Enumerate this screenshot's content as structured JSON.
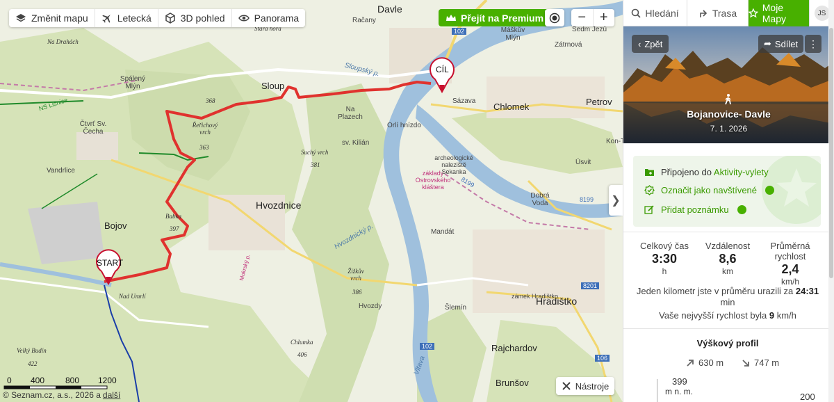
{
  "toolbar": {
    "change_map": "Změnit mapu",
    "aerial": "Letecká",
    "view3d": "3D pohled",
    "panorama": "Panorama"
  },
  "premium_label": "Přejít na Premium",
  "zoom": {
    "minus": "−",
    "plus": "+"
  },
  "map_labels": {
    "davle": "Davle",
    "sloup": "Sloup",
    "hvozdnice": "Hvozdnice",
    "bojov": "Bojov",
    "chlomek": "Chlomek",
    "petrov": "Petrov",
    "hradistko": "Hradištko",
    "rajchardov": "Rajchardov",
    "brunsov": "Brunšov",
    "ctvrt_sv_cecha": "Čtvrť Sv. Čecha",
    "spaleny_mlyn": "Spálený Mlýn",
    "vrchy_na_drahach": "Na Drahách",
    "vandrlice": "Vandrlice",
    "rechovy_vrch": "Řeřichový vrch",
    "babka": "Babka",
    "suchy_vrch": "Suchý vrch",
    "zizkuv_vrch": "Žižkův vrch",
    "chlumka": "Chlumka",
    "velky_budin": "Velký Budín",
    "nad_umrli": "Nad Umrlí",
    "stara_hora": "Stará hora",
    "na_plazech": "Na Plazech",
    "sazava": "Sázava",
    "orli_hnizdo": "Orlí hnízdo",
    "sv_kilian": "sv. Kilián",
    "usvit": "Úsvit",
    "dobra_voda": "Dobrá Voda",
    "mandat": "Mandát",
    "slemin": "Šlemín",
    "hvozdy": "Hvozdy",
    "zamek_hradistko": "zámek Hradištko",
    "maskuv_mlyn": "Máškův Mlýn",
    "seidm_jezu": "Sedm Jezů",
    "zatrnova": "Zátrnová",
    "kon_t": "Kon-T",
    "zaklady_klastera": "základy Ostrovského kláštera",
    "archeologicke": "archeologické naleziště Sekanka",
    "racany": "Račany",
    "h368": "368",
    "h363": "363",
    "h381": "381",
    "h397": "397",
    "h386": "386",
    "h406": "406",
    "h422": "422",
    "road102a": "102",
    "road102b": "102",
    "road106": "106",
    "r8201": "8201",
    "r8199a": "8199",
    "r8199b": "8199",
    "ns_lisnice": "NS Lišnice",
    "sloupsky_p": "Sloupský p.",
    "hvozdnicky_p": "Hvozdnický p.",
    "vltava": "Vltava",
    "mokrsky_p": "Mokrský p."
  },
  "markers": {
    "start": "START",
    "finish": "CÍL"
  },
  "scale": {
    "t0": "0",
    "t1": "400",
    "t2": "800",
    "t3": "1200"
  },
  "copyright": {
    "text": "© Seznam.cz, a.s., 2026 a",
    "link": "další"
  },
  "tools_label": "Nástroje",
  "tabs": {
    "search": "Hledání",
    "route": "Trasa",
    "my_maps": "Moje Mapy",
    "avatar": "JS"
  },
  "route": {
    "back": "Zpět",
    "share": "Sdílet",
    "more": "⋮",
    "title": "Bojanovice- Davle",
    "date": "7. 1. 2026"
  },
  "info": {
    "connected_prefix": "Připojeno do",
    "connected_link": "Aktivity-vylety",
    "mark_visited": "Označit jako navštívené",
    "add_note": "Přidat poznámku"
  },
  "stats": {
    "time_label": "Celkový čas",
    "time_value": "3:30",
    "time_unit": "h",
    "dist_label": "Vzdálenost",
    "dist_value": "8,6",
    "dist_unit": "km",
    "speed_label_1": "Průměrná",
    "speed_label_2": "rychlost",
    "speed_value": "2,4",
    "speed_unit": "km/h",
    "pace_prefix": "Jeden kilometr jste v průměru urazili za",
    "pace_value": "24:31",
    "pace_unit": "min",
    "max_speed_prefix": "Vaše nejvyšší rychlost byla",
    "max_speed_value": "9",
    "max_speed_unit": "km/h"
  },
  "profile": {
    "title": "Výškový profil",
    "ascent": "630 m",
    "descent": "747 m",
    "max_label": "399",
    "max_unit": "m n. m.",
    "axis_right": "200"
  },
  "colors": {
    "accent": "#48b000",
    "route": "#e0322e",
    "river": "#9fc0dd"
  }
}
